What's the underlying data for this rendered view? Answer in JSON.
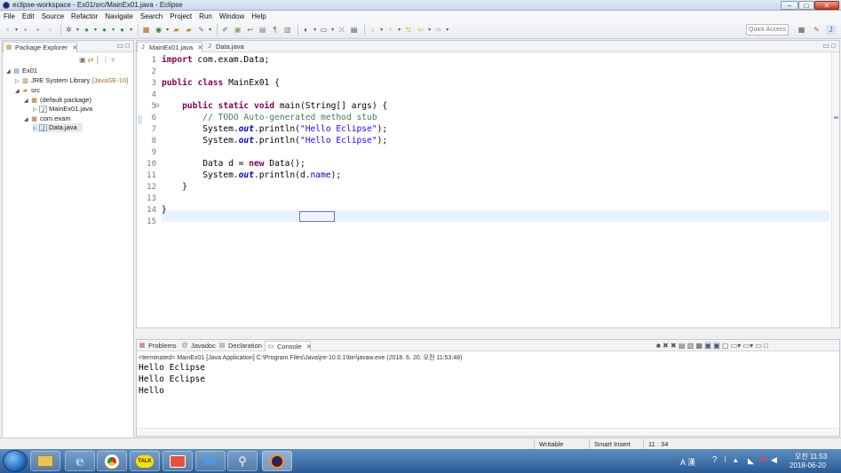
{
  "window": {
    "title": "eclipse-workspace - Ex01/src/MainEx01.java - Eclipse",
    "controls": {
      "minimize": "–",
      "maximize": "□",
      "close": "✕"
    }
  },
  "menu": [
    "File",
    "Edit",
    "Source",
    "Refactor",
    "Navigate",
    "Search",
    "Project",
    "Run",
    "Window",
    "Help"
  ],
  "toolbar": {
    "quick_access_placeholder": "Quick Access"
  },
  "package_explorer": {
    "tab_label": "Package Explorer",
    "tree": [
      {
        "label": "Ex01",
        "expanded": true
      },
      {
        "label": "JRE System Library",
        "decoration": "[JavaSE-10]",
        "expanded": false
      },
      {
        "label": "src",
        "expanded": true
      },
      {
        "label": "(default package)",
        "expanded": true
      },
      {
        "label": "MainEx01.java",
        "expanded": false
      },
      {
        "label": "com.exam",
        "expanded": true
      },
      {
        "label": "Data.java",
        "expanded": false,
        "selected": true
      }
    ]
  },
  "editor": {
    "tabs": [
      {
        "label": "MainEx01.java",
        "active": true
      },
      {
        "label": "Data.java",
        "active": false
      }
    ],
    "line_numbers": [
      "1",
      "2",
      "3",
      "4",
      "5",
      "6",
      "7",
      "8",
      "9",
      "10",
      "11",
      "12",
      "13",
      "14",
      "15"
    ],
    "code_lines": [
      "import com.exam.Data;",
      "",
      "public class MainEx01 {",
      "",
      "    public static void main(String[] args) {",
      "        // TODO Auto-generated method stub",
      "        System.out.println(\"Hello Eclipse\");",
      "        System.out.println(\"Hello Eclipse\");",
      "",
      "        Data d = new Data();",
      "        System.out.println(d.name);",
      "    }",
      "",
      "}",
      ""
    ]
  },
  "console": {
    "tabs": [
      "Problems",
      "Javadoc",
      "Declaration",
      "Console"
    ],
    "active_tab": "Console",
    "info": "<terminated> MainEx01 [Java Application] C:\\Program Files\\Java\\jre-10.0.1\\bin\\javaw.exe (2018. 6. 20. 오전 11:53:48)",
    "output": [
      "Hello Eclipse",
      "Hello Eclipse",
      "Hello"
    ]
  },
  "status": {
    "writable": "Writable",
    "insert_mode": "Smart Insert",
    "position": "11 : 34"
  },
  "taskbar": {
    "apps": [
      "explorer",
      "ie",
      "chrome",
      "kakaotalk",
      "media",
      "vscode",
      "search-tool",
      "eclipse"
    ],
    "tray_ime": "A 漢",
    "clock_time": "오전 11:53",
    "clock_date": "2018-06-20"
  },
  "colors": {
    "keyword": "#7f0055",
    "comment": "#3f7f5f",
    "string": "#2a00ff",
    "field": "#0000c0",
    "current_line": "#e8f2fe"
  }
}
